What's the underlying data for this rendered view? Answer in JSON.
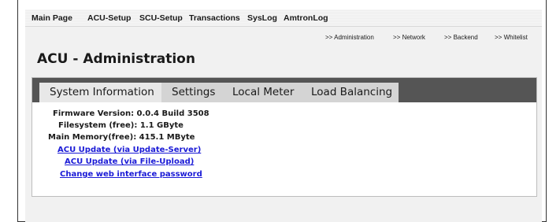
{
  "topnav": {
    "items": [
      "Main Page",
      "ACU-Setup",
      "SCU-Setup",
      "Transactions",
      "SysLog",
      "AmtronLog"
    ]
  },
  "subnav": {
    "items": [
      ">> Administration",
      ">> Network",
      ">> Backend",
      ">> Whitelist"
    ]
  },
  "page_title": "ACU - Administration",
  "tabs": [
    {
      "label": "System Information",
      "active": true
    },
    {
      "label": "Settings",
      "active": false
    },
    {
      "label": "Local Meter",
      "active": false
    },
    {
      "label": "Load Balancing",
      "active": false
    }
  ],
  "system_info": {
    "firmware": "Firmware Version: 0.0.4 Build 3508",
    "filesystem": "Filesystem (free): 1.1 GByte",
    "memory": "Main Memory(free): 415.1 MByte"
  },
  "links": {
    "update_server": "ACU Update (via Update-Server)",
    "update_file": "ACU Update (via File-Upload)",
    "change_password": "Change web interface password"
  },
  "colors": {
    "tabbar": "#555555",
    "active_tab": "#e8e8e8",
    "inactive_tab": "#d4d4d4",
    "link": "#1a1ad6"
  }
}
